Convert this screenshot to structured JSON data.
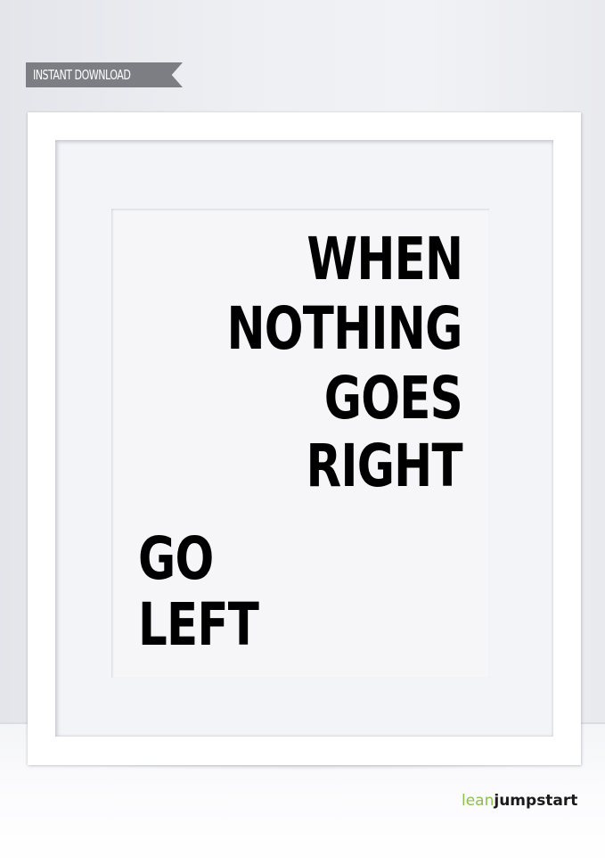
{
  "banner": {
    "label": "INSTANT DOWNLOAD"
  },
  "poster": {
    "right_lines": [
      "WHEN",
      "NOTHING",
      "GOES",
      "RIGHT"
    ],
    "left_lines": [
      "GO",
      "LEFT"
    ]
  },
  "logo": {
    "part1": "lean",
    "part2": "jumpstart"
  },
  "colors": {
    "banner_bg": "#7c7e83",
    "logo_green": "#8cc04a",
    "text": "#000000"
  }
}
